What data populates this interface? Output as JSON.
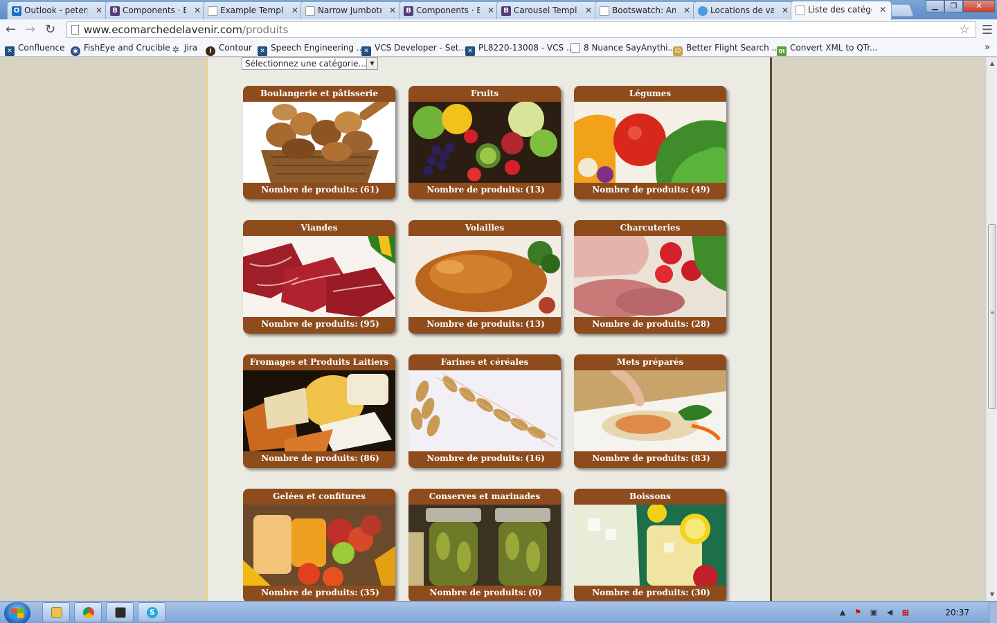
{
  "browser": {
    "tabs": [
      {
        "label": "Outlook - peterp",
        "icon": "outlook-icon"
      },
      {
        "label": "Components · B",
        "icon": "bootstrap-icon"
      },
      {
        "label": "Example Templa",
        "icon": "page-icon"
      },
      {
        "label": "Narrow Jumbotr",
        "icon": "page-icon"
      },
      {
        "label": "Components · B",
        "icon": "bootstrap-icon"
      },
      {
        "label": "Carousel Templ",
        "icon": "bootstrap-icon"
      },
      {
        "label": "Bootswatch: Am",
        "icon": "page-icon"
      },
      {
        "label": "Locations de vac",
        "icon": "airbnb-icon"
      },
      {
        "label": "Liste des catégo",
        "icon": "page-icon",
        "active": true
      }
    ],
    "url": {
      "host": "www.ecomarchedelavenir.com",
      "path": "/produits"
    },
    "bookmarks": [
      {
        "label": "Confluence",
        "icon": "atlassian-icon"
      },
      {
        "label": "FishEye and Crucible",
        "icon": "fisheye-icon"
      },
      {
        "label": "Jira",
        "icon": "jira-icon"
      },
      {
        "label": "Contour",
        "icon": "contour-icon"
      },
      {
        "label": "Speech Engineering ...",
        "icon": "atlassian-icon"
      },
      {
        "label": "VCS Developer - Set...",
        "icon": "atlassian-icon"
      },
      {
        "label": "PL8220-13008 - VCS ...",
        "icon": "atlassian-icon"
      },
      {
        "label": "8 Nuance SayAnythi...",
        "icon": "page-icon"
      },
      {
        "label": "Better Flight Search ...",
        "icon": "flight-icon"
      },
      {
        "label": "Convert XML to QTr...",
        "icon": "qt-icon"
      }
    ],
    "bookmarks_more": "»"
  },
  "page": {
    "category_select": "Sélectionnez une catégorie...",
    "count_label": "Nombre de produits:",
    "categories": [
      {
        "name": "Boulangerie et pâtisserie",
        "count": "(61)",
        "image": "bread"
      },
      {
        "name": "Fruits",
        "count": "(13)",
        "image": "fruits"
      },
      {
        "name": "Légumes",
        "count": "(49)",
        "image": "vegetables"
      },
      {
        "name": "Viandes",
        "count": "(95)",
        "image": "meat"
      },
      {
        "name": "Volailles",
        "count": "(13)",
        "image": "poultry"
      },
      {
        "name": "Charcuteries",
        "count": "(28)",
        "image": "deli"
      },
      {
        "name": "Fromages et Produits Laitiers",
        "count": "(86)",
        "image": "cheese"
      },
      {
        "name": "Farines et céréales",
        "count": "(16)",
        "image": "wheat"
      },
      {
        "name": "Mets préparés",
        "count": "(83)",
        "image": "prepared"
      },
      {
        "name": "Gelées et confitures",
        "count": "(35)",
        "image": "jams"
      },
      {
        "name": "Conserves et marinades",
        "count": "(0)",
        "image": "pickles"
      },
      {
        "name": "Boissons",
        "count": "(30)",
        "image": "lemonade"
      }
    ]
  },
  "taskbar": {
    "clock": "20:37",
    "apps": [
      "explorer-icon",
      "chrome-icon",
      "terminal-icon",
      "skype-icon"
    ]
  },
  "colors": {
    "card_brown": "#8e4b1c",
    "page_background": "#d8d2c2",
    "panel_background": "#ecebe3"
  }
}
